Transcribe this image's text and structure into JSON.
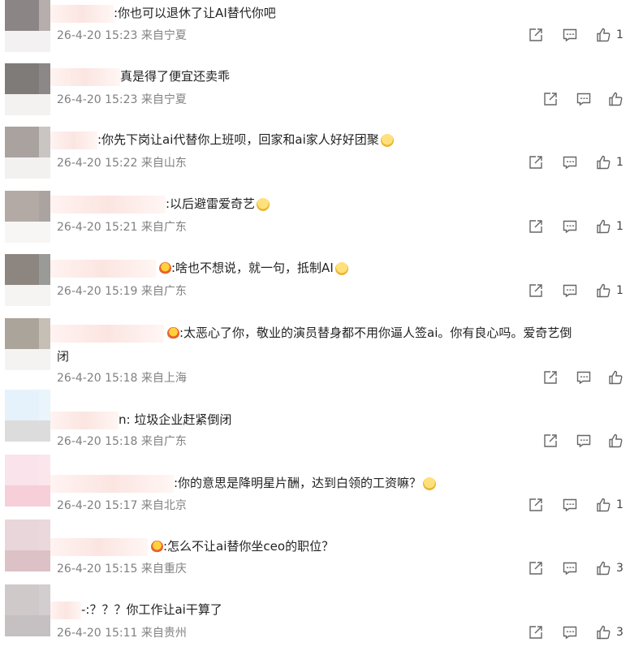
{
  "colors": {
    "text": "#222222",
    "meta": "#808080",
    "icon": "#666666"
  },
  "comments": [
    {
      "name_suffix": "",
      "text": ":你也可以退休了让AI替代你吧",
      "text2": "",
      "time": "26-4-20 15:23",
      "location": "来自宁夏",
      "likes": "1",
      "avatar": [
        "#8b8586",
        "#b5aead",
        "#f4f1f2"
      ],
      "emoji": ""
    },
    {
      "name_suffix": "",
      "text": "真是得了便宜还卖乖",
      "text2": "",
      "time": "26-4-20 15:23",
      "location": "来自宁夏",
      "likes": "",
      "avatar": [
        "#7f7b79",
        "#8c8888",
        "#f4f2f0"
      ],
      "emoji": ""
    },
    {
      "name_suffix": "",
      "text": ":你先下岗让ai代替你上班呗，回家和ai家人好好团聚",
      "text2": "",
      "time": "26-4-20 15:22",
      "location": "来自山东",
      "likes": "1",
      "avatar": [
        "#a9a29f",
        "#c9c5c3",
        "#f3f1f0"
      ],
      "emoji": "kiss"
    },
    {
      "name_suffix": "",
      "text": ":以后避雷爱奇艺",
      "text2": "",
      "time": "26-4-20 15:21",
      "location": "来自广东",
      "likes": "1",
      "avatar": [
        "#b3aaa5",
        "#aba3a0",
        "#f7f6f5"
      ],
      "emoji": "cry"
    },
    {
      "name_suffix": "",
      "text": ":啥也不想说，就一句，抵制AI",
      "text2": "",
      "time": "26-4-20 15:19",
      "location": "来自广东",
      "likes": "1",
      "avatar": [
        "#8d8580",
        "#9a9a98",
        "#f5f4f3"
      ],
      "emoji": "smile"
    },
    {
      "name_suffix": "",
      "text": ":太恶心了你，敬业的演员替身都不用你逼人签ai。你有良心吗。爱奇艺倒",
      "text2": "闭",
      "time": "26-4-20 15:18",
      "location": "来自上海",
      "likes": "",
      "avatar": [
        "#aba49b",
        "#c6bfb6",
        "#f4f3f1"
      ],
      "emoji": ""
    },
    {
      "name_suffix": "n",
      "text": ": 垃圾企业赶紧倒闭",
      "text2": "",
      "time": "26-4-20 15:18",
      "location": "来自广东",
      "likes": "",
      "avatar": [
        "#e6f2fb",
        "#e9f4fb",
        "#dcdcdc"
      ],
      "emoji": ""
    },
    {
      "name_suffix": "",
      "text": ":你的意思是降明星片酬，达到白领的工资嘛？",
      "text2": "",
      "time": "26-4-20 15:17",
      "location": "来自北京",
      "likes": "1",
      "avatar": [
        "#fae3ea",
        "#fbe6ec",
        "#f6cfd8"
      ],
      "emoji": "dog"
    },
    {
      "name_suffix": "",
      "text": ":怎么不让ai替你坐ceo的职位？",
      "text2": "",
      "time": "26-4-20 15:15",
      "location": "来自重庆",
      "likes": "3",
      "avatar": [
        "#e9d6da",
        "#ead8dc",
        "#dcc1c6"
      ],
      "emoji": ""
    },
    {
      "name_suffix": "-",
      "text": ":？？？你工作让ai干算了",
      "text2": "",
      "time": "26-4-20 15:11",
      "location": "来自贵州",
      "likes": "3",
      "avatar": [
        "#cfc9ca",
        "#d2cdce",
        "#c5c0c1"
      ],
      "emoji": ""
    }
  ]
}
